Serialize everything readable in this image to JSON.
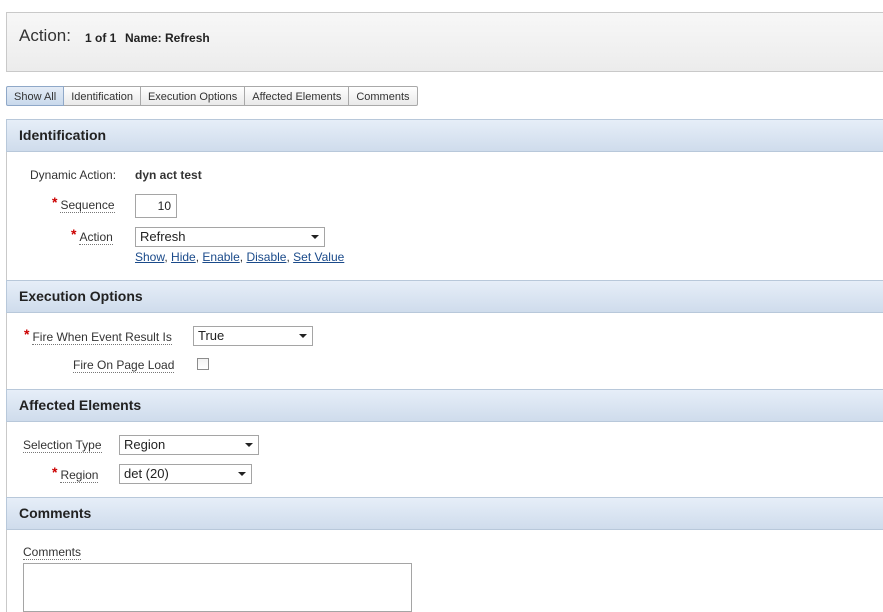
{
  "header": {
    "title": "Action:",
    "count": "1 of 1",
    "name": "Name: Refresh"
  },
  "tabs": [
    "Show All",
    "Identification",
    "Execution Options",
    "Affected Elements",
    "Comments"
  ],
  "identification": {
    "heading": "Identification",
    "dynamic_action_label": "Dynamic Action:",
    "dynamic_action_value": "dyn act test",
    "sequence_label": "Sequence",
    "sequence_value": "10",
    "action_label": "Action",
    "action_value": "Refresh",
    "links": [
      "Show",
      "Hide",
      "Enable",
      "Disable",
      "Set Value"
    ]
  },
  "execution": {
    "heading": "Execution Options",
    "fire_when_label": "Fire When Event Result Is",
    "fire_when_value": "True",
    "fire_on_load_label": "Fire On Page Load",
    "fire_on_load_checked": false
  },
  "affected": {
    "heading": "Affected Elements",
    "selection_type_label": "Selection Type",
    "selection_type_value": "Region",
    "region_label": "Region",
    "region_value": "det (20)"
  },
  "comments": {
    "heading": "Comments",
    "comments_label": "Comments",
    "comments_value": ""
  },
  "colors": {
    "required": "#cc0000",
    "section_bg": "#dce6f2",
    "link": "#1a4a8a"
  }
}
